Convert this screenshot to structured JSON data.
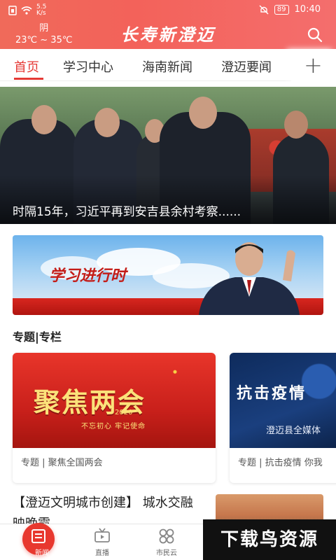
{
  "status_bar": {
    "network_speed": "5.5\nK/s",
    "battery": "89",
    "time": "10:40"
  },
  "header": {
    "weather_condition": "阴",
    "temperature": "23℃ ~ 35℃",
    "brand": "长寿新澄迈",
    "search_icon": "search-icon"
  },
  "tabs": [
    {
      "label": "首页",
      "active": true
    },
    {
      "label": "学习中心"
    },
    {
      "label": "海南新闻"
    },
    {
      "label": "澄迈要闻"
    }
  ],
  "tabs_more_icon": "plus-icon",
  "hero": {
    "caption": "时隔15年，习近平再到安吉县余村考察......"
  },
  "banner": {
    "title": "学习进行时"
  },
  "section": {
    "title": "专题|专栏"
  },
  "cards": [
    {
      "title": "聚焦两会",
      "year": "2020",
      "slogan": "不忘初心 牢记使命",
      "caption": "专题 | 聚焦全国两会"
    },
    {
      "title": "抗击疫情",
      "subtitle": "澄迈县全媒体",
      "caption": "专题 | 抗击疫情 你我"
    }
  ],
  "news": {
    "headline": "【澄迈文明城市创建】 城水交融映晚霞"
  },
  "tabbar": [
    {
      "label": "新闻",
      "icon": "news-icon",
      "active": true
    },
    {
      "label": "直播",
      "icon": "tv-icon"
    },
    {
      "label": "市民云",
      "icon": "grid-icon"
    }
  ],
  "watermark": "下载鸟资源",
  "colors": {
    "brand_red": "#e53935",
    "header_gradient_start": "#f06a5a",
    "tabbar_active": "#e8382f"
  }
}
